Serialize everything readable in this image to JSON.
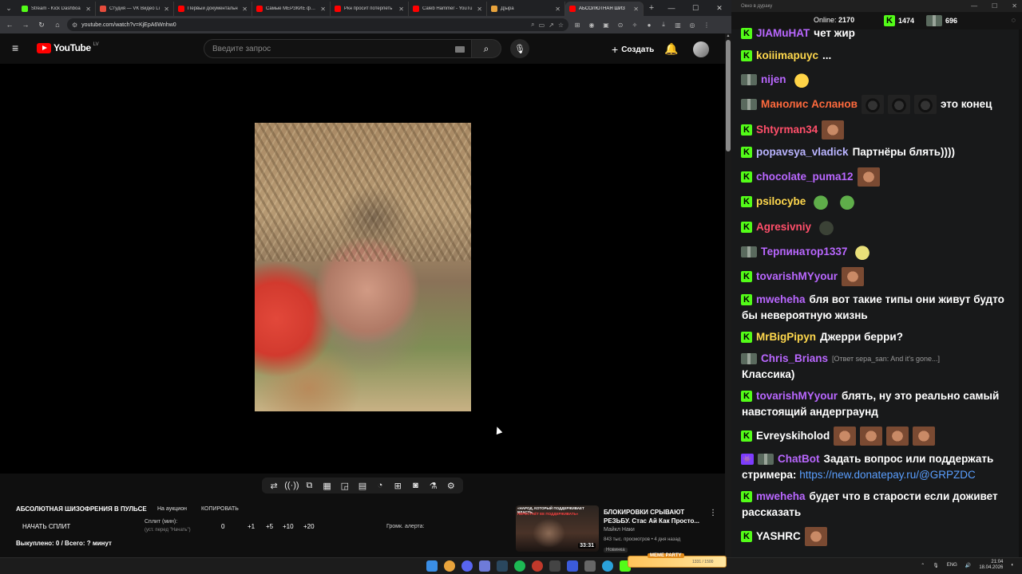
{
  "browser": {
    "tabs": [
      {
        "label": "Stream - Kick Dashboa",
        "color": "#53fc18"
      },
      {
        "label": "Студия — VK Видео Li",
        "color": "#e74c3c"
      },
      {
        "label": "Первый документальн",
        "color": "#ff0000"
      },
      {
        "label": "Самые МЕРЗКИЕ фору",
        "color": "#ff0000"
      },
      {
        "label": "Ркн просит потерпеть",
        "color": "#ff0000"
      },
      {
        "label": "Caleb Hammer - YouTu",
        "color": "#ff0000"
      },
      {
        "label": "Д|ыра",
        "color": "#e8a33c"
      },
      {
        "label": "АБСОЛЮТНАЯ ШИЗ",
        "color": "#ff0000"
      }
    ],
    "url": "youtube.com/watch?v=KjEpA6Wnhw0"
  },
  "youtube": {
    "logo_text": "YouTube",
    "region": "LV",
    "search_placeholder": "Введите запрос",
    "create_label": "Создать"
  },
  "split": {
    "title": "АБСОЛЮТНАЯ ШИЗОФРЕНИЯ В ПУЛЬСЕ",
    "auction": "На аукцион",
    "copy": "КОПИРОВАТЬ",
    "start": "НАЧАТЬ СПЛИТ",
    "split_label": "Сплит (мин):",
    "split_hint": "(уст. перед \"Начать\")",
    "value": "0",
    "inc1": "+1",
    "inc5": "+5",
    "inc10": "+10",
    "inc20": "+20",
    "alert_label": "Громк. алерта:",
    "bought": "Выкуплено: 0 / Всего: ? минут"
  },
  "recommended": {
    "thumb_text": "«НАРОД, КОТОРЫЙ ПОДДЕРЖИВАЕТ ВЛАСТЬ,",
    "thumb_red": "ПЕРЕСТАЁТ ЕЕ ПОДДЕРЖИВАТЬ»",
    "duration": "33:31",
    "title": "БЛОКИРОВКИ СРЫВАЮТ РЕЗЬБУ. Стас Ай Как Просто...",
    "channel": "Майкл Наки",
    "meta": "843 тыс. просмотров • 4 дня назад",
    "badge": "Новинка"
  },
  "chat": {
    "window_title": "Окно в дураку",
    "online_label": "Online:",
    "online_count": "2170",
    "stat1": "1474",
    "stat2": "696",
    "messages": [
      {
        "user": "JIAMuHAT",
        "color": "#b967ff",
        "text": "чет жир"
      },
      {
        "user": "koiiimapuyc",
        "color": "#ffd84d",
        "text": "..."
      },
      {
        "user": "nijen",
        "color": "#b967ff",
        "text": ""
      },
      {
        "user": "Манолис Асланов",
        "color": "#ff6a3d",
        "text": "это конец"
      },
      {
        "user": "Shtyrman34",
        "color": "#ff4f6a",
        "text": ""
      },
      {
        "user": "popavsya_vladick",
        "color": "#b9b4ff",
        "text": "Партнёры блять))))"
      },
      {
        "user": "chocolate_puma12",
        "color": "#b967ff",
        "text": ""
      },
      {
        "user": "psilocybe",
        "color": "#ffd84d",
        "text": ""
      },
      {
        "user": "Agresivniy",
        "color": "#ff4f6a",
        "text": ""
      },
      {
        "user": "Терпинатор1337",
        "color": "#b967ff",
        "text": ""
      },
      {
        "user": "tovarishMYyour",
        "color": "#b967ff",
        "text": ""
      },
      {
        "user": "mweheha",
        "color": "#b967ff",
        "text": "бля вот такие типы они живут будто",
        "cont": "бы невероятную жизнь"
      },
      {
        "user": "MrBigPipyn",
        "color": "#ffd84d",
        "text": "Джерри берри?"
      },
      {
        "user": "Chris_Brians",
        "color": "#b967ff",
        "reply": "[Ответ sepa_san: And it's gone...]",
        "cont": "Классика)"
      },
      {
        "user": "tovarishMYyour",
        "color": "#b967ff",
        "text": "блять, ну это реально самый",
        "cont": "навстоящий андерграунд"
      },
      {
        "user": "Evreyskiholod",
        "color": "#ffffff",
        "text": ""
      },
      {
        "user": "ChatBot",
        "color": "#b967ff",
        "text": "Задать вопрос или поддержать",
        "cont": "стримера:",
        "link": "https://new.donatepay.ru/@GRPZDC"
      },
      {
        "user": "mweheha",
        "color": "#b967ff",
        "text": "будет что в старости если доживет",
        "cont": "рассказать"
      },
      {
        "user": "YASHRC",
        "color": "#ffffff",
        "text": ""
      }
    ]
  },
  "taskbar": {
    "meme_title": "MEME PARTY",
    "meme_sub": "1331 / 1500",
    "lang": "ENG",
    "time": "21:04",
    "date": "18.04.2026"
  }
}
